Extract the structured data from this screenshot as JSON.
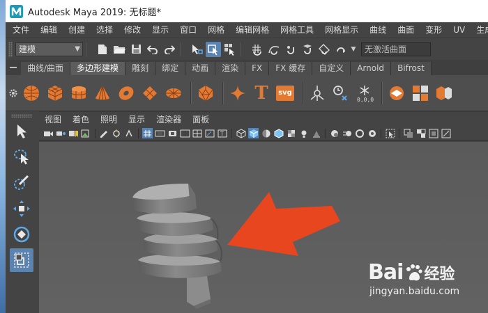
{
  "window": {
    "title": "Autodesk Maya 2019: 无标题*"
  },
  "menubar": {
    "items": [
      "文件",
      "编辑",
      "创建",
      "选择",
      "修改",
      "显示",
      "窗口",
      "网格",
      "编辑网格",
      "网格工具",
      "网格显示",
      "曲线",
      "曲面",
      "变形",
      "UV",
      "生成"
    ]
  },
  "statusline": {
    "mode": "建模",
    "live_surface": "无激活曲面"
  },
  "shelf": {
    "tabs": [
      "曲线/曲面",
      "多边形建模",
      "雕刻",
      "绑定",
      "动画",
      "渲染",
      "FX",
      "FX 缓存",
      "自定义",
      "Arnold",
      "Bifrost"
    ],
    "active_tab": "多边形建模",
    "svg_label": "svg",
    "text_label": "T"
  },
  "panel": {
    "menus": [
      "视图",
      "着色",
      "照明",
      "显示",
      "渲染器",
      "面板"
    ]
  },
  "watermark": {
    "brand": "Bai",
    "brand_suffix": "经验",
    "url": "jingyan.baidu.com"
  },
  "colors": {
    "accent_blue": "#5b83b0",
    "arrow_orange": "#e8461e",
    "shelf_orange": "#e07a35",
    "viewport_bg": "#5d5d5d"
  },
  "icons": [
    "maya-logo-icon",
    "select-tool-icon",
    "lasso-tool-icon",
    "paint-select-icon",
    "move-tool-icon",
    "rotate-tool-icon",
    "scale-tool-icon",
    "gear-icon"
  ]
}
